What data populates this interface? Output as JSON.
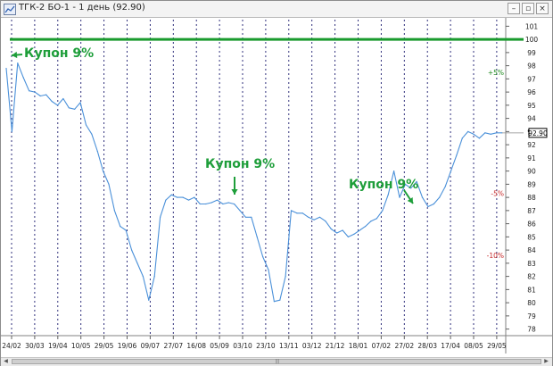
{
  "window": {
    "title": "ТГК-2 БО-1 - 1 день (92.90)",
    "icon": "chart-window-icon",
    "buttons": [
      "minimize-icon",
      "maximize-icon",
      "close-icon"
    ]
  },
  "colors": {
    "price_line": "#4a90d9",
    "level_line": "#1a9b2e",
    "annotation": "#1e9e3a",
    "grid": "#1a1a6e",
    "pct_positive": "#1e8a1e",
    "pct_negative": "#c62828",
    "current_value_box": "#000000"
  },
  "chart_data": {
    "type": "line",
    "title": "",
    "xlabel": "",
    "ylabel": "",
    "ylim": [
      77.5,
      101.5
    ],
    "y_ticks": [
      78,
      79,
      80,
      81,
      82,
      83,
      84,
      85,
      86,
      87,
      88,
      89,
      90,
      91,
      92,
      93,
      94,
      95,
      96,
      97,
      98,
      99,
      100,
      101
    ],
    "x_tick_labels": [
      "24/02",
      "30/03",
      "19/04",
      "10/05",
      "29/05",
      "19/06",
      "09/07",
      "27/07",
      "16/08",
      "05/09",
      "03/10",
      "23/10",
      "13/11",
      "03/12",
      "21/12",
      "18/01",
      "07/02",
      "27/02",
      "28/03",
      "17/04",
      "08/05",
      "29/05"
    ],
    "grid": "vertical dotted lines at tick labels",
    "current_value": "92.90",
    "horizontal_level": 100,
    "percent_markers": [
      {
        "label": "+5%",
        "value": 97.5,
        "sign": "positive"
      },
      {
        "label": "-5%",
        "value": 88.3,
        "sign": "negative"
      },
      {
        "label": "-10%",
        "value": 83.6,
        "sign": "negative"
      }
    ],
    "annotations": [
      {
        "text": "Купон 9%",
        "position": "top-left near 24/02"
      },
      {
        "text": "Купон 9%",
        "position": "above 05/09–03/10"
      },
      {
        "text": "Купон 9%",
        "position": "near 27/02–28/03"
      }
    ],
    "series": [
      {
        "x": [
          0,
          1,
          2,
          3,
          4,
          5,
          6,
          7,
          8,
          9,
          10,
          11,
          12,
          13,
          14,
          15,
          16,
          17,
          18,
          19,
          20,
          21,
          22,
          23,
          24,
          25,
          26,
          27,
          28,
          29,
          30,
          31,
          32,
          33,
          34,
          35,
          36,
          37,
          38,
          39,
          40,
          41,
          42,
          43,
          44,
          45,
          46,
          47,
          48,
          49,
          50,
          51,
          52,
          53,
          54,
          55,
          56,
          57,
          58,
          59,
          60,
          61,
          62,
          63,
          64,
          65,
          66,
          67,
          68,
          69,
          70,
          71,
          72,
          73,
          74,
          75,
          76,
          77,
          78,
          79,
          80,
          81,
          82,
          83,
          84,
          85,
          86,
          87
        ],
        "values": [
          97.8,
          93.0,
          98.2,
          97.1,
          96.1,
          96.0,
          95.7,
          95.8,
          95.3,
          95.0,
          95.5,
          94.8,
          94.7,
          95.2,
          93.5,
          92.8,
          91.5,
          90.0,
          89.0,
          87.0,
          85.8,
          85.5,
          84.0,
          83.0,
          82.0,
          80.2,
          82.0,
          86.5,
          87.8,
          88.2,
          88.0,
          88.0,
          87.8,
          88.0,
          87.5,
          87.5,
          87.6,
          87.8,
          87.5,
          87.6,
          87.5,
          87.0,
          86.5,
          86.5,
          85.0,
          83.5,
          82.5,
          80.1,
          80.2,
          82.0,
          87.0,
          86.8,
          86.8,
          86.5,
          86.3,
          86.5,
          86.2,
          85.6,
          85.3,
          85.5,
          85.0,
          85.2,
          85.5,
          85.8,
          86.2,
          86.4,
          87.0,
          88.2,
          90.0,
          88.0,
          89.0,
          88.7,
          89.2,
          88.0,
          87.3,
          87.5,
          88.0,
          88.8,
          90.0,
          91.2,
          92.5,
          93.0,
          92.8,
          92.5,
          92.9,
          92.8,
          92.9,
          92.9
        ]
      }
    ]
  }
}
